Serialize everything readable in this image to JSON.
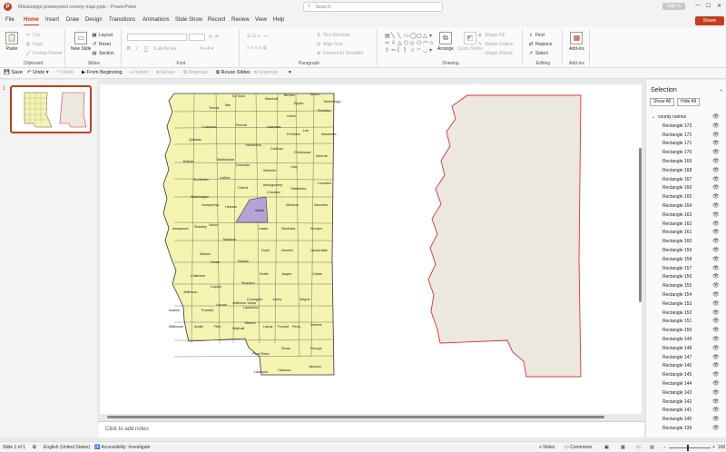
{
  "window": {
    "title": "Mississippi powerpoint county map.pptx  -  PowerPoint",
    "search_placeholder": "Search",
    "signin": "Sign in"
  },
  "menu": {
    "tabs": [
      "File",
      "Home",
      "Insert",
      "Draw",
      "Design",
      "Transitions",
      "Animations",
      "Slide Show",
      "Record",
      "Review",
      "View",
      "Help"
    ],
    "share": "Share"
  },
  "ribbon": {
    "clipboard": {
      "label": "Clipboard",
      "paste": "Paste",
      "cut": "Cut",
      "copy": "Copy",
      "format_painter": "Format Painter"
    },
    "slides": {
      "label": "Slides",
      "new_slide": "New Slide",
      "layout": "Layout",
      "reset": "Reset",
      "section": "Section"
    },
    "font": {
      "label": "Font"
    },
    "paragraph": {
      "label": "Paragraph",
      "text_direction": "Text Direction",
      "align_text": "Align Text",
      "convert_smartart": "Convert to SmartArt"
    },
    "drawing": {
      "label": "Drawing",
      "arrange": "Arrange",
      "quick_styles": "Quick Styles",
      "shape_fill": "Shape Fill",
      "shape_outline": "Shape Outline",
      "shape_effects": "Shape Effects"
    },
    "editing": {
      "label": "Editing",
      "find": "Find",
      "replace": "Replace",
      "select": "Select"
    },
    "addins": {
      "label": "Add-ins",
      "addins_btn": "Add-ins"
    }
  },
  "qat": {
    "save": "Save",
    "undo": "Undo",
    "redo": "Redo",
    "from_beginning": "From Beginning",
    "indent": "Indent",
    "group": "Group",
    "regroup": "Regroup",
    "reuse_slides": "Reuse Slides",
    "ungroup": "Ungroup"
  },
  "thumbnails": {
    "slide_number": "1"
  },
  "map": {
    "county_labels": [
      "De Soto",
      "Marshall",
      "Benton",
      "Tippah",
      "Alcorn",
      "Tishomingo",
      "Tunica",
      "Tate",
      "Prentiss",
      "Union",
      "Coahoma",
      "Panola",
      "Lafayette",
      "Pontotoc",
      "Lee",
      "Itawamba",
      "Quitman",
      "Yalobusha",
      "Calhoun",
      "Chickasaw",
      "Monroe",
      "Bolivar",
      "Tallahatchie",
      "Grenada",
      "Webster",
      "Clay",
      "Sunflower",
      "Leflore",
      "Carroll",
      "Montgomery",
      "Choctaw",
      "Oktibbeha",
      "Lowndes",
      "Washington",
      "Holmes",
      "Attala",
      "Winston",
      "Noxubee",
      "Humphreys",
      "Sharkey",
      "Yazoo",
      "Madison",
      "Leake",
      "Neshoba",
      "Kemper",
      "Issaquena",
      "Warren",
      "Hinds",
      "Rankin",
      "Scott",
      "Newton",
      "Lauderdale",
      "Claiborne",
      "Copiah",
      "Simpson",
      "Smith",
      "Jasper",
      "Clarke",
      "Jefferson",
      "Lincoln",
      "Covington",
      "Jones",
      "Wayne",
      "Adams",
      "Franklin",
      "Lawrence",
      "Jefferson Davis",
      "Wilkinson",
      "Amite",
      "Pike",
      "Walthall",
      "Marion",
      "Lamar",
      "Forrest",
      "Perry",
      "Greene",
      "Pearl River",
      "Stone",
      "George",
      "Hancock",
      "Harrison",
      "Jackson"
    ],
    "highlighted_county": "Attala",
    "fill_color": "#f4f4b0",
    "highlight_color": "#b7a2d6",
    "outline_fill": "#ece8df",
    "outline_stroke": "#e03030"
  },
  "notes": {
    "placeholder": "Click to add notes"
  },
  "selection_pane": {
    "title": "Selection",
    "show_all": "Show All",
    "hide_all": "Hide All",
    "group_name": "county names",
    "items": [
      "Rectangle 173",
      "Rectangle 172",
      "Rectangle 171",
      "Rectangle 170",
      "Rectangle 169",
      "Rectangle 168",
      "Rectangle 167",
      "Rectangle 166",
      "Rectangle 165",
      "Rectangle 164",
      "Rectangle 163",
      "Rectangle 162",
      "Rectangle 161",
      "Rectangle 160",
      "Rectangle 159",
      "Rectangle 158",
      "Rectangle 157",
      "Rectangle 156",
      "Rectangle 155",
      "Rectangle 154",
      "Rectangle 153",
      "Rectangle 152",
      "Rectangle 151",
      "Rectangle 150",
      "Rectangle 149",
      "Rectangle 148",
      "Rectangle 147",
      "Rectangle 146",
      "Rectangle 145",
      "Rectangle 144",
      "Rectangle 143",
      "Rectangle 142",
      "Rectangle 141",
      "Rectangle 140",
      "Rectangle 139"
    ]
  },
  "status": {
    "slide_info": "Slide 1 of 1",
    "language": "English (United States)",
    "accessibility": "Accessibility: Investigate",
    "notes": "Notes",
    "comments": "Comments",
    "zoom": "160"
  }
}
